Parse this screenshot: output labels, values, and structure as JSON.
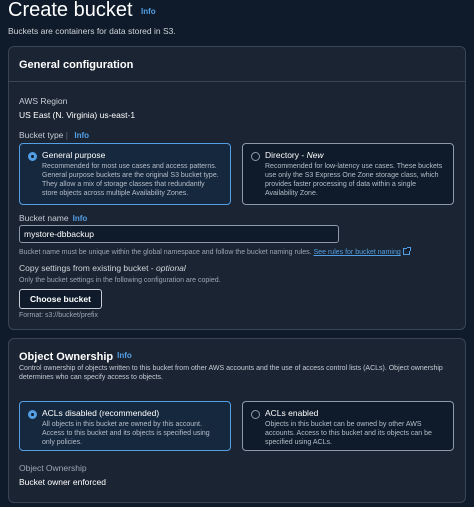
{
  "header": {
    "title": "Create bucket",
    "info": "Info",
    "description": "Buckets are containers for data stored in S3."
  },
  "general": {
    "title": "General configuration",
    "region_label": "AWS Region",
    "region_value": "US East (N. Virginia) us-east-1",
    "bucket_type_label": "Bucket type",
    "bucket_type_info": "Info",
    "options": [
      {
        "title": "General purpose",
        "desc": "Recommended for most use cases and access patterns. General purpose buckets are the original S3 bucket type. They allow a mix of storage classes that redundantly store objects across multiple Availability Zones.",
        "selected": true
      },
      {
        "title": "Directory - ",
        "title_suffix": "New",
        "desc": "Recommended for low-latency use cases. These buckets use only the S3 Express One Zone storage class, which provides faster processing of data within a single Availability Zone.",
        "selected": false
      }
    ],
    "bucket_name_label": "Bucket name",
    "bucket_name_info": "Info",
    "bucket_name_value": "mystore-dbbackup",
    "bucket_name_hint": "Bucket name must be unique within the global namespace and follow the bucket naming rules.",
    "bucket_name_link": "See rules for bucket naming",
    "copy_label": "Copy settings from existing bucket - ",
    "copy_label_optional": "optional",
    "copy_hint": "Only the bucket settings in the following configuration are copied.",
    "choose_button": "Choose bucket",
    "format_hint": "Format: s3://bucket/prefix"
  },
  "ownership": {
    "title": "Object Ownership",
    "info": "Info",
    "description": "Control ownership of objects written to this bucket from other AWS accounts and the use of access control lists (ACLs). Object ownership determines who can specify access to objects.",
    "options": [
      {
        "title": "ACLs disabled (recommended)",
        "desc": "All objects in this bucket are owned by this account. Access to this bucket and its objects is specified using only policies.",
        "selected": true
      },
      {
        "title": "ACLs enabled",
        "desc": "Objects in this bucket can be owned by other AWS accounts. Access to this bucket and its objects can be specified using ACLs.",
        "selected": false
      }
    ],
    "ownership_label": "Object Ownership",
    "ownership_value": "Bucket owner enforced"
  },
  "colors": {
    "background": "#0f1b2a",
    "panel": "#1b2432",
    "accent": "#539fe5"
  }
}
